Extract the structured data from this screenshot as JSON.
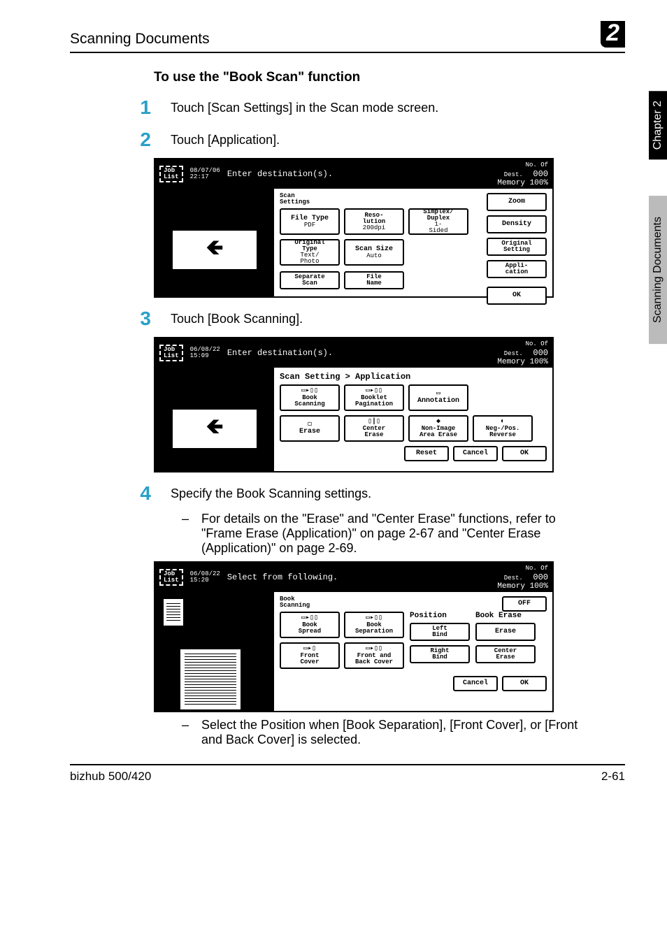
{
  "header": {
    "title": "Scanning Documents",
    "chapterBadge": "2"
  },
  "sideTabs": {
    "black": "Chapter 2",
    "gray": "Scanning Documents"
  },
  "sectionTitle": "To use the \"Book Scan\" function",
  "steps": {
    "s1": {
      "num": "1",
      "text": "Touch [Scan Settings] in the Scan mode screen."
    },
    "s2": {
      "num": "2",
      "text": "Touch [Application]."
    },
    "s3": {
      "num": "3",
      "text": "Touch [Book Scanning]."
    },
    "s4": {
      "num": "4",
      "text": "Specify the Book Scanning settings."
    }
  },
  "bullets": {
    "b1": "For details on the \"Erase\" and \"Center Erase\" functions, refer to \"Frame Erase (Application)\" on page 2-67 and \"Center Erase (Application)\" on page 2-69.",
    "b2": "Select the Position when [Book Separation], [Front Cover], or [Front and Back Cover] is selected."
  },
  "lcd1": {
    "jobList": "Job\nList",
    "datetime": "08/07/06\n22:17",
    "prompt": "Enter destination(s).",
    "destLabel": "No. Of\nDest.",
    "destCount": "000",
    "memory": "Memory 100%",
    "panelLabel": "Scan\nSettings",
    "fileType": "File Type",
    "pdf": "PDF",
    "resolution": "Reso-\nlution",
    "dpi": "200dpi",
    "simplex": "Simplex/\nDuplex",
    "sided": "1-\nSided",
    "origType": "Original\nType",
    "textPhoto": "Text/\nPhoto",
    "scanSize": "Scan Size",
    "auto": "Auto",
    "separate": "Separate\nScan",
    "fileName": "File\nName",
    "zoom": "Zoom",
    "density": "Density",
    "origSetting": "Original\nSetting",
    "application": "Appli-\ncation",
    "ok": "OK"
  },
  "lcd2": {
    "jobList": "Job\nList",
    "datetime": "06/08/22\n15:09",
    "prompt": "Enter destination(s).",
    "destLabel": "No. Of\nDest.",
    "destCount": "000",
    "memory": "Memory 100%",
    "breadcrumb": "Scan Setting > Application",
    "bookScanning": "Book\nScanning",
    "bookletPag": "Booklet\nPagination",
    "annotation": "Annotation",
    "erase": "Erase",
    "centerErase": "Center\nErase",
    "nonImage": "Non-Image\nArea Erase",
    "negPos": "Neg-/Pos.\nReverse",
    "reset": "Reset",
    "cancel": "Cancel",
    "ok": "OK"
  },
  "lcd3": {
    "jobList": "Job\nList",
    "datetime": "06/08/22\n15:20",
    "prompt": "Select from following.",
    "destLabel": "No. Of\nDest.",
    "destCount": "000",
    "memory": "Memory 100%",
    "panelLabel": "Book\nScanning",
    "bookSpread": "Book\nSpread",
    "bookSeparation": "Book\nSeparation",
    "frontCover": "Front\nCover",
    "frontBackCover": "Front and\nBack Cover",
    "position": "Position",
    "leftBind": "Left\nBind",
    "rightBind": "Right\nBind",
    "bookErase": "Book Erase",
    "erase": "Erase",
    "centerErase": "Center\nErase",
    "off": "OFF",
    "cancel": "Cancel",
    "ok": "OK"
  },
  "footer": {
    "left": "bizhub 500/420",
    "right": "2-61"
  }
}
